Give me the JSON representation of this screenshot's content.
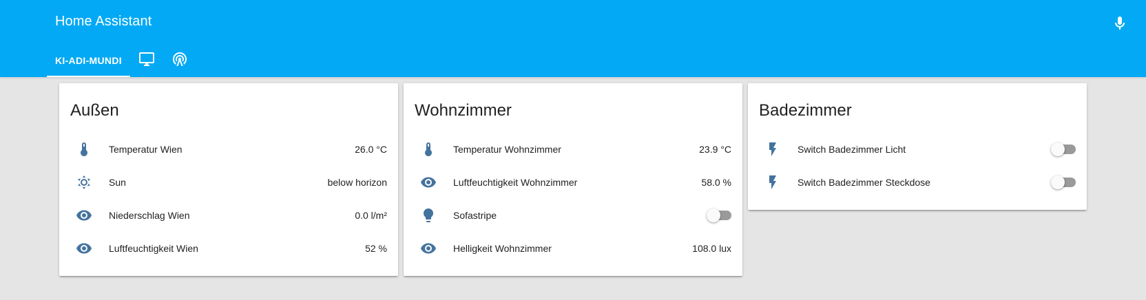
{
  "header": {
    "title": "Home Assistant",
    "tabs": [
      {
        "label": "KI-ADI-MUNDI",
        "active": true
      },
      {
        "icon": "monitor-icon"
      },
      {
        "icon": "radio-tower-icon"
      }
    ]
  },
  "colors": {
    "primary": "#03a9f4",
    "icon": "#44739e",
    "background": "#e5e5e5"
  },
  "cards": [
    {
      "title": "Außen",
      "rows": [
        {
          "icon": "thermometer-icon",
          "name": "Temperatur Wien",
          "value": "26.0 °C"
        },
        {
          "icon": "sun-icon",
          "name": "Sun",
          "value": "below horizon"
        },
        {
          "icon": "eye-icon",
          "name": "Niederschlag Wien",
          "value": "0.0 l/m²"
        },
        {
          "icon": "eye-icon",
          "name": "Luftfeuchtigkeit Wien",
          "value": "52 %"
        }
      ]
    },
    {
      "title": "Wohnzimmer",
      "rows": [
        {
          "icon": "thermometer-icon",
          "name": "Temperatur Wohnzimmer",
          "value": "23.9 °C"
        },
        {
          "icon": "eye-icon",
          "name": "Luftfeuchtigkeit Wohnzimmer",
          "value": "58.0 %"
        },
        {
          "icon": "lightbulb-icon",
          "name": "Sofastripe",
          "toggle": "off"
        },
        {
          "icon": "eye-icon",
          "name": "Helligkeit Wohnzimmer",
          "value": "108.0 lux"
        }
      ]
    },
    {
      "title": "Badezimmer",
      "rows": [
        {
          "icon": "flash-icon",
          "name": "Switch Badezimmer Licht",
          "toggle": "off"
        },
        {
          "icon": "flash-icon",
          "name": "Switch Badezimmer Steckdose",
          "toggle": "off"
        }
      ]
    }
  ]
}
